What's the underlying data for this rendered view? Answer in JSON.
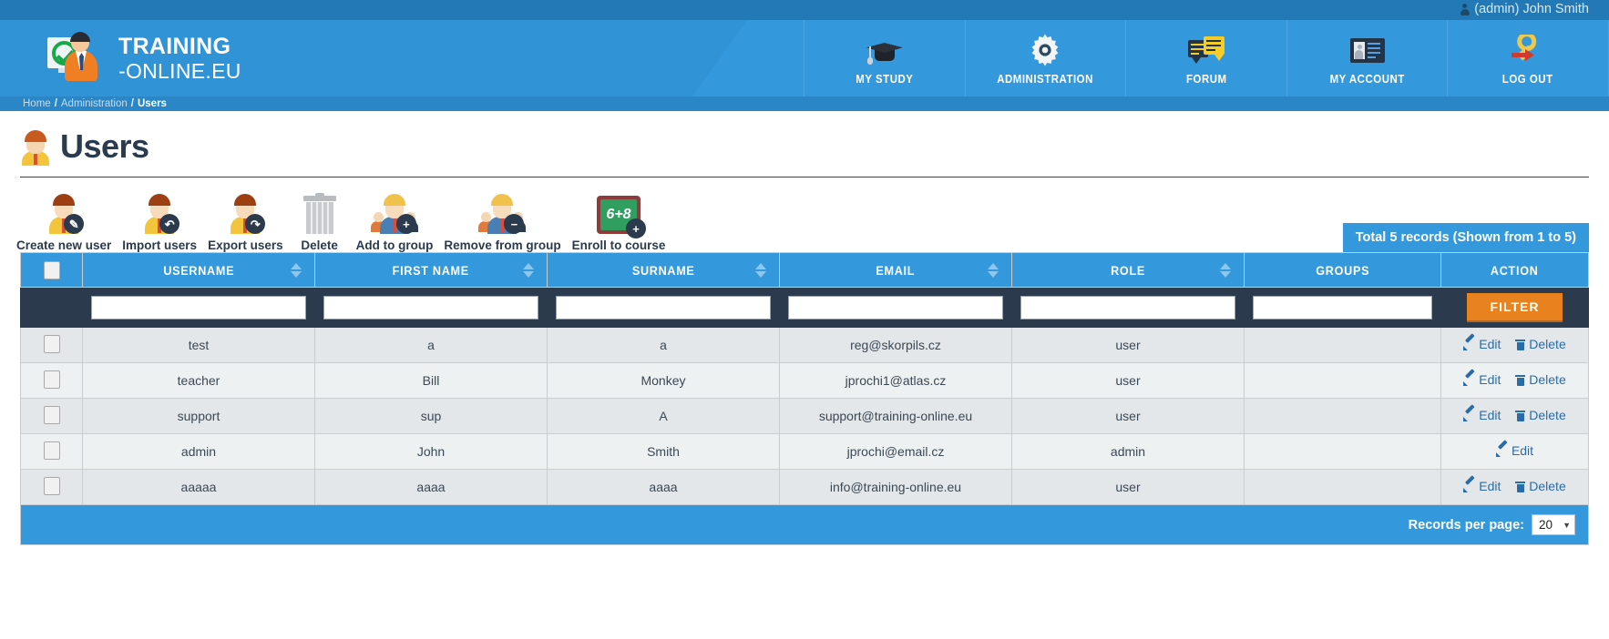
{
  "topbar": {
    "user_label": "(admin) John Smith",
    "user_icon": "person-icon"
  },
  "brand": {
    "line1": "TRAINING",
    "line2": "-ONLINE.EU",
    "logo_icon": "training-online-logo-icon"
  },
  "nav": {
    "items": [
      {
        "label": "MY STUDY",
        "icon": "graduation-cap-icon"
      },
      {
        "label": "ADMINISTRATION",
        "icon": "gear-icon"
      },
      {
        "label": "FORUM",
        "icon": "speech-bubbles-icon"
      },
      {
        "label": "MY ACCOUNT",
        "icon": "id-card-icon"
      },
      {
        "label": "LOG OUT",
        "icon": "key-logout-icon"
      }
    ]
  },
  "breadcrumb": {
    "home": "Home",
    "administration": "Administration",
    "current": "Users",
    "separator": "/"
  },
  "page": {
    "title": "Users",
    "title_icon": "user-avatar-icon"
  },
  "toolbar": {
    "items": [
      {
        "label": "Create new user",
        "icon": "user-add-icon"
      },
      {
        "label": "Import users",
        "icon": "user-import-icon"
      },
      {
        "label": "Export users",
        "icon": "user-export-icon"
      },
      {
        "label": "Delete",
        "icon": "trash-icon"
      },
      {
        "label": "Add to group",
        "icon": "group-add-icon"
      },
      {
        "label": "Remove from group",
        "icon": "group-remove-icon"
      },
      {
        "label": "Enroll to course",
        "icon": "course-enroll-icon"
      }
    ]
  },
  "records_badge": "Total 5 records (Shown from 1 to 5)",
  "table": {
    "columns": [
      {
        "label": "",
        "key": "check",
        "sortable": false
      },
      {
        "label": "USERNAME",
        "key": "username",
        "sortable": true
      },
      {
        "label": "FIRST NAME",
        "key": "firstname",
        "sortable": true
      },
      {
        "label": "SURNAME",
        "key": "surname",
        "sortable": true
      },
      {
        "label": "EMAIL",
        "key": "email",
        "sortable": true
      },
      {
        "label": "ROLE",
        "key": "role",
        "sortable": true
      },
      {
        "label": "GROUPS",
        "key": "groups",
        "sortable": false
      },
      {
        "label": "ACTION",
        "key": "action",
        "sortable": false
      }
    ],
    "filter": {
      "username": "",
      "firstname": "",
      "surname": "",
      "email": "",
      "role": "",
      "groups": "",
      "button_label": "FILTER"
    },
    "rows": [
      {
        "username": "test",
        "firstname": "a",
        "surname": "a",
        "email": "reg@skorpils.cz",
        "role": "user",
        "groups": "",
        "actions": [
          "Edit",
          "Delete"
        ]
      },
      {
        "username": "teacher",
        "firstname": "Bill",
        "surname": "Monkey",
        "email": "jprochi1@atlas.cz",
        "role": "user",
        "groups": "",
        "actions": [
          "Edit",
          "Delete"
        ]
      },
      {
        "username": "support",
        "firstname": "sup",
        "surname": "A",
        "email": "support@training-online.eu",
        "role": "user",
        "groups": "",
        "actions": [
          "Edit",
          "Delete"
        ]
      },
      {
        "username": "admin",
        "firstname": "John",
        "surname": "Smith",
        "email": "jprochi@email.cz",
        "role": "admin",
        "groups": "",
        "actions": [
          "Edit"
        ]
      },
      {
        "username": "aaaaa",
        "firstname": "aaaa",
        "surname": "aaaa",
        "email": "info@training-online.eu",
        "role": "user",
        "groups": "",
        "actions": [
          "Edit",
          "Delete"
        ]
      }
    ]
  },
  "footer": {
    "records_per_page_label": "Records per page:",
    "records_per_page_value": "20"
  },
  "colors": {
    "brand_blue": "#3498dc",
    "header_blue": "#2279b5",
    "dark_navy": "#2b3a4c",
    "orange": "#e8821e",
    "link_blue": "#2a6ca8"
  }
}
